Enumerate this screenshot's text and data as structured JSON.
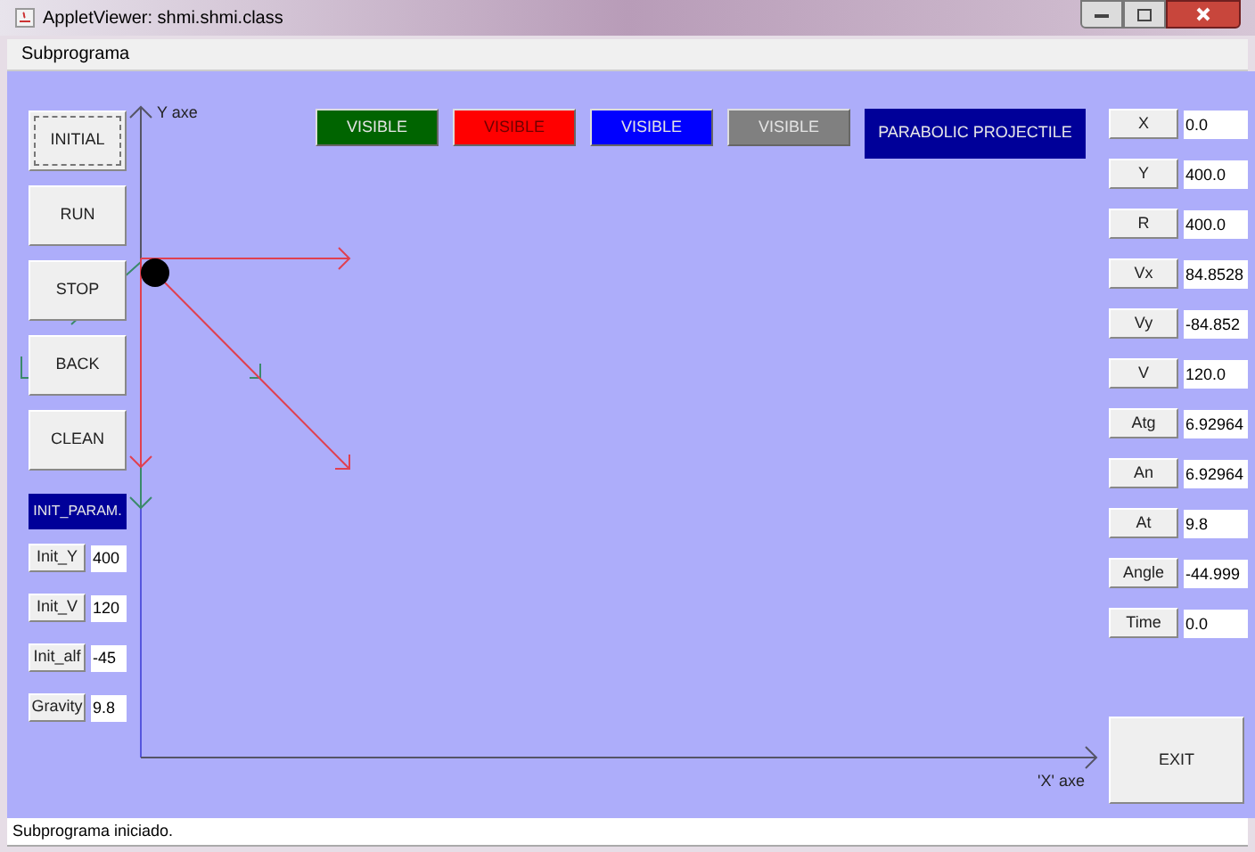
{
  "window": {
    "title": "AppletViewer: shmi.shmi.class"
  },
  "menu": [
    "Subprograma"
  ],
  "controls": [
    {
      "label": "INITIAL",
      "focused": true
    },
    {
      "label": "RUN",
      "focused": false
    },
    {
      "label": "STOP",
      "focused": false
    },
    {
      "label": "BACK",
      "focused": false
    },
    {
      "label": "CLEAN",
      "focused": false
    }
  ],
  "init_title": "INIT_PARAM.",
  "init_params": [
    {
      "label": "Init_Y",
      "value": "400"
    },
    {
      "label": "Init_V",
      "value": "120"
    },
    {
      "label": "Init_alf",
      "value": "-45"
    },
    {
      "label": "Gravity",
      "value": "9.8"
    }
  ],
  "visible_buttons": [
    {
      "label": "VISIBLE",
      "color": "#006400"
    },
    {
      "label": "VISIBLE",
      "color": "#ff0000"
    },
    {
      "label": "VISIBLE",
      "color": "#0000ff"
    },
    {
      "label": "VISIBLE",
      "color": "#808080"
    }
  ],
  "title_label": "PARABOLIC PROJECTILE",
  "axes": {
    "y_label": "Y axe",
    "x_label": "'X' axe"
  },
  "readouts": [
    {
      "label": "X",
      "value": "0.0"
    },
    {
      "label": "Y",
      "value": "400.0"
    },
    {
      "label": "R",
      "value": "400.0"
    },
    {
      "label": "Vx",
      "value": "84.8528"
    },
    {
      "label": "Vy",
      "value": "-84.852"
    },
    {
      "label": "V",
      "value": "120.0"
    },
    {
      "label": "Atg",
      "value": "6.92964"
    },
    {
      "label": "An",
      "value": "6.92964"
    },
    {
      "label": "At",
      "value": "9.8"
    },
    {
      "label": "Angle",
      "value": "-44.999"
    },
    {
      "label": "Time",
      "value": "0.0"
    }
  ],
  "exit": "EXIT",
  "status": "Subprograma iniciado."
}
